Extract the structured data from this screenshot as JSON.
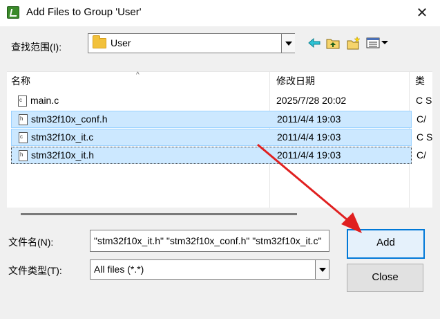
{
  "window": {
    "title": "Add Files to Group 'User'",
    "close_glyph": "✕",
    "app_icon": "keil-uvision-icon"
  },
  "lookin": {
    "label": "查找范围(I):",
    "value": "User"
  },
  "toolbar": {
    "icons": [
      "back-arrow-icon",
      "up-folder-icon",
      "new-folder-icon",
      "view-menu-icon"
    ]
  },
  "list": {
    "columns": [
      "名称",
      "修改日期",
      "类"
    ],
    "rows": [
      {
        "name": "main.c",
        "date": "2025/7/28 20:02",
        "type": "C S",
        "icon": "c",
        "state": "normal"
      },
      {
        "name": "stm32f10x_conf.h",
        "date": "2011/4/4 19:03",
        "type": "C/",
        "icon": "h",
        "state": "selected"
      },
      {
        "name": "stm32f10x_it.c",
        "date": "2011/4/4 19:03",
        "type": "C S",
        "icon": "c",
        "state": "selected"
      },
      {
        "name": "stm32f10x_it.h",
        "date": "2011/4/4 19:03",
        "type": "C/",
        "icon": "h",
        "state": "focused"
      }
    ]
  },
  "filename": {
    "label": "文件名(N):",
    "value": "\"stm32f10x_it.h\" \"stm32f10x_conf.h\" \"stm32f10x_it.c\""
  },
  "filetype": {
    "label": "文件类型(T):",
    "value": "All files (*.*)"
  },
  "buttons": {
    "add": "Add",
    "close": "Close"
  },
  "colors": {
    "selection": "#cce8ff",
    "selection_border": "#99d1ff",
    "annotation_arrow": "#e02020",
    "default_button_border": "#0078d7"
  }
}
